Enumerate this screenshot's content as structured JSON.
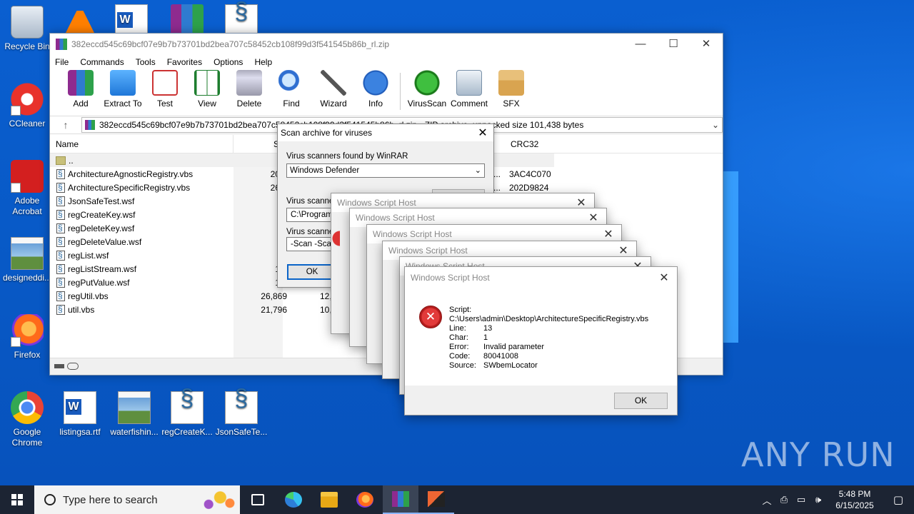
{
  "desktop": {
    "icons_left": [
      {
        "label": "Recycle Bin"
      },
      {
        "label": "CCleaner"
      },
      {
        "label": "Adobe Acrobat"
      },
      {
        "label": "designeddi..."
      },
      {
        "label": "Firefox"
      },
      {
        "label": "Google Chrome"
      }
    ],
    "icons_bottom": [
      {
        "label": "listingsa.rtf"
      },
      {
        "label": "waterfishin..."
      },
      {
        "label": "regCreateK..."
      },
      {
        "label": "JsonSafeTe..."
      }
    ],
    "watermark": "ANY RUN"
  },
  "winrar": {
    "title": "382eccd545c69bcf07e9b7b73701bd2bea707c58452cb108f99d3f541545b86b_rl.zip",
    "menu": [
      "File",
      "Commands",
      "Tools",
      "Favorites",
      "Options",
      "Help"
    ],
    "toolbar": [
      {
        "label": "Add",
        "icon": "add-icon"
      },
      {
        "label": "Extract To",
        "icon": "extract-icon"
      },
      {
        "label": "Test",
        "icon": "test-icon"
      },
      {
        "label": "View",
        "icon": "view-icon"
      },
      {
        "label": "Delete",
        "icon": "delete-icon"
      },
      {
        "label": "Find",
        "icon": "find-icon"
      },
      {
        "label": "Wizard",
        "icon": "wizard-icon"
      },
      {
        "label": "Info",
        "icon": "info-icon"
      },
      {
        "label": "VirusScan",
        "icon": "virusscan-icon"
      },
      {
        "label": "Comment",
        "icon": "comment-icon"
      },
      {
        "label": "SFX",
        "icon": "sfx-icon"
      }
    ],
    "address": "382eccd545c69bcf07e9b7b73701bd2bea707c58452cb108f99d3f541545b86b_rl.zip - ZIP archive, unpacked size 101,438 bytes",
    "columns": {
      "name": "Name",
      "size": "S",
      "crc": "CRC32"
    },
    "files": [
      {
        "name": "..",
        "size": "",
        "packed": "",
        "crc": "",
        "dots": ""
      },
      {
        "name": "ArchitectureAgnosticRegistry.vbs",
        "size": "20,6",
        "packed": "",
        "crc": "3AC4C070",
        "dots": "..."
      },
      {
        "name": "ArchitectureSpecificRegistry.vbs",
        "size": "26,2",
        "packed": "",
        "crc": "202D9824",
        "dots": "..."
      },
      {
        "name": "JsonSafeTest.wsf",
        "size": "2",
        "packed": "",
        "crc": "",
        "dots": ""
      },
      {
        "name": "regCreateKey.wsf",
        "size": "7",
        "packed": "",
        "crc": "",
        "dots": ""
      },
      {
        "name": "regDeleteKey.wsf",
        "size": "6",
        "packed": "",
        "crc": "",
        "dots": ""
      },
      {
        "name": "regDeleteValue.wsf",
        "size": "7",
        "packed": "",
        "crc": "",
        "dots": ""
      },
      {
        "name": "regList.wsf",
        "size": "9",
        "packed": "",
        "crc": "",
        "dots": ""
      },
      {
        "name": "regListStream.wsf",
        "size": "1,0",
        "packed": "",
        "crc": "",
        "dots": ""
      },
      {
        "name": "regPutValue.wsf",
        "size": "1,3",
        "packed": "",
        "crc": "",
        "dots": ""
      },
      {
        "name": "regUtil.vbs",
        "size": "26,869",
        "packed": "12,",
        "crc": "",
        "dots": ""
      },
      {
        "name": "util.vbs",
        "size": "21,796",
        "packed": "10,",
        "crc": "",
        "dots": ""
      }
    ]
  },
  "scan_dialog": {
    "title": "Scan archive for viruses",
    "found_label": "Virus scanners found by WinRAR",
    "scanner": "Windows Defender",
    "path_label": "Virus scanner",
    "path_value": "C:\\Program",
    "params_label": "Virus scanner",
    "params_value": "-Scan -Scan",
    "ok": "OK"
  },
  "wsh": {
    "title": "Windows Script Host",
    "script_label": "Script:",
    "script_path": "C:\\Users\\admin\\Desktop\\ArchitectureSpecificRegistry.vbs",
    "fields": [
      {
        "key": "Line:",
        "value": "13"
      },
      {
        "key": "Char:",
        "value": "1"
      },
      {
        "key": "Error:",
        "value": "Invalid parameter"
      },
      {
        "key": "Code:",
        "value": "80041008"
      },
      {
        "key": "Source:",
        "value": "SWbemLocator"
      }
    ],
    "ok": "OK"
  },
  "taskbar": {
    "search_placeholder": "Type here to search",
    "time": "5:48 PM",
    "date": "6/15/2025"
  }
}
